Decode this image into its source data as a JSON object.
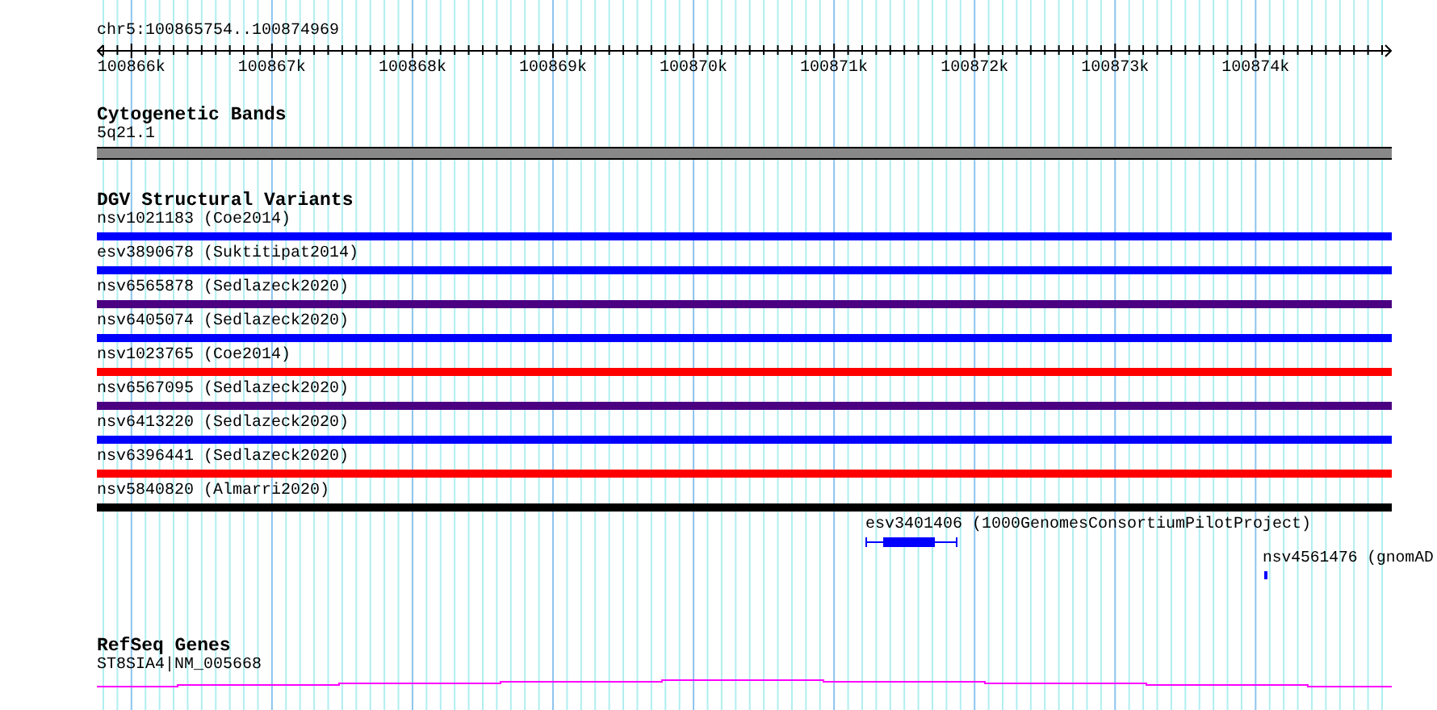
{
  "ruler": {
    "range": "chr5:100865754..100874969",
    "ticks": [
      "100866k",
      "100867k",
      "100868k",
      "100869k",
      "100870k",
      "100871k",
      "100872k",
      "100873k",
      "100874k"
    ]
  },
  "cytogenetic_bands": {
    "title": "Cytogenetic Bands",
    "bands": [
      {
        "name": "5q21.1"
      }
    ]
  },
  "dgv": {
    "title": "DGV Structural Variants",
    "variants": [
      {
        "label": "nsv1021183 (Coe2014)",
        "kind": "full",
        "color": "#0000ff"
      },
      {
        "label": "esv3890678 (Suktitipat2014)",
        "kind": "full",
        "color": "#0000ff"
      },
      {
        "label": "nsv6565878 (Sedlazeck2020)",
        "kind": "full",
        "color": "#4b0082"
      },
      {
        "label": "nsv6405074 (Sedlazeck2020)",
        "kind": "full",
        "color": "#0000ff"
      },
      {
        "label": "nsv1023765 (Coe2014)",
        "kind": "full",
        "color": "#ff0000"
      },
      {
        "label": "nsv6567095 (Sedlazeck2020)",
        "kind": "full",
        "color": "#4b0082"
      },
      {
        "label": "nsv6413220 (Sedlazeck2020)",
        "kind": "full",
        "color": "#0000ff"
      },
      {
        "label": "nsv6396441 (Sedlazeck2020)",
        "kind": "full",
        "color": "#ff0000"
      },
      {
        "label": "nsv5840820 (Almarri2020)",
        "kind": "full",
        "color": "#000000"
      },
      {
        "label": "esv3401406 (1000GenomesConsortiumPilotProject)",
        "kind": "gapped",
        "color": "#0000ff"
      },
      {
        "label": "nsv4561476 (gnomAD",
        "kind": "small",
        "color": "#0000ff"
      }
    ]
  },
  "refseq": {
    "title": "RefSeq Genes",
    "genes": [
      {
        "label": "ST8SIA4|NM_005668"
      }
    ]
  }
}
